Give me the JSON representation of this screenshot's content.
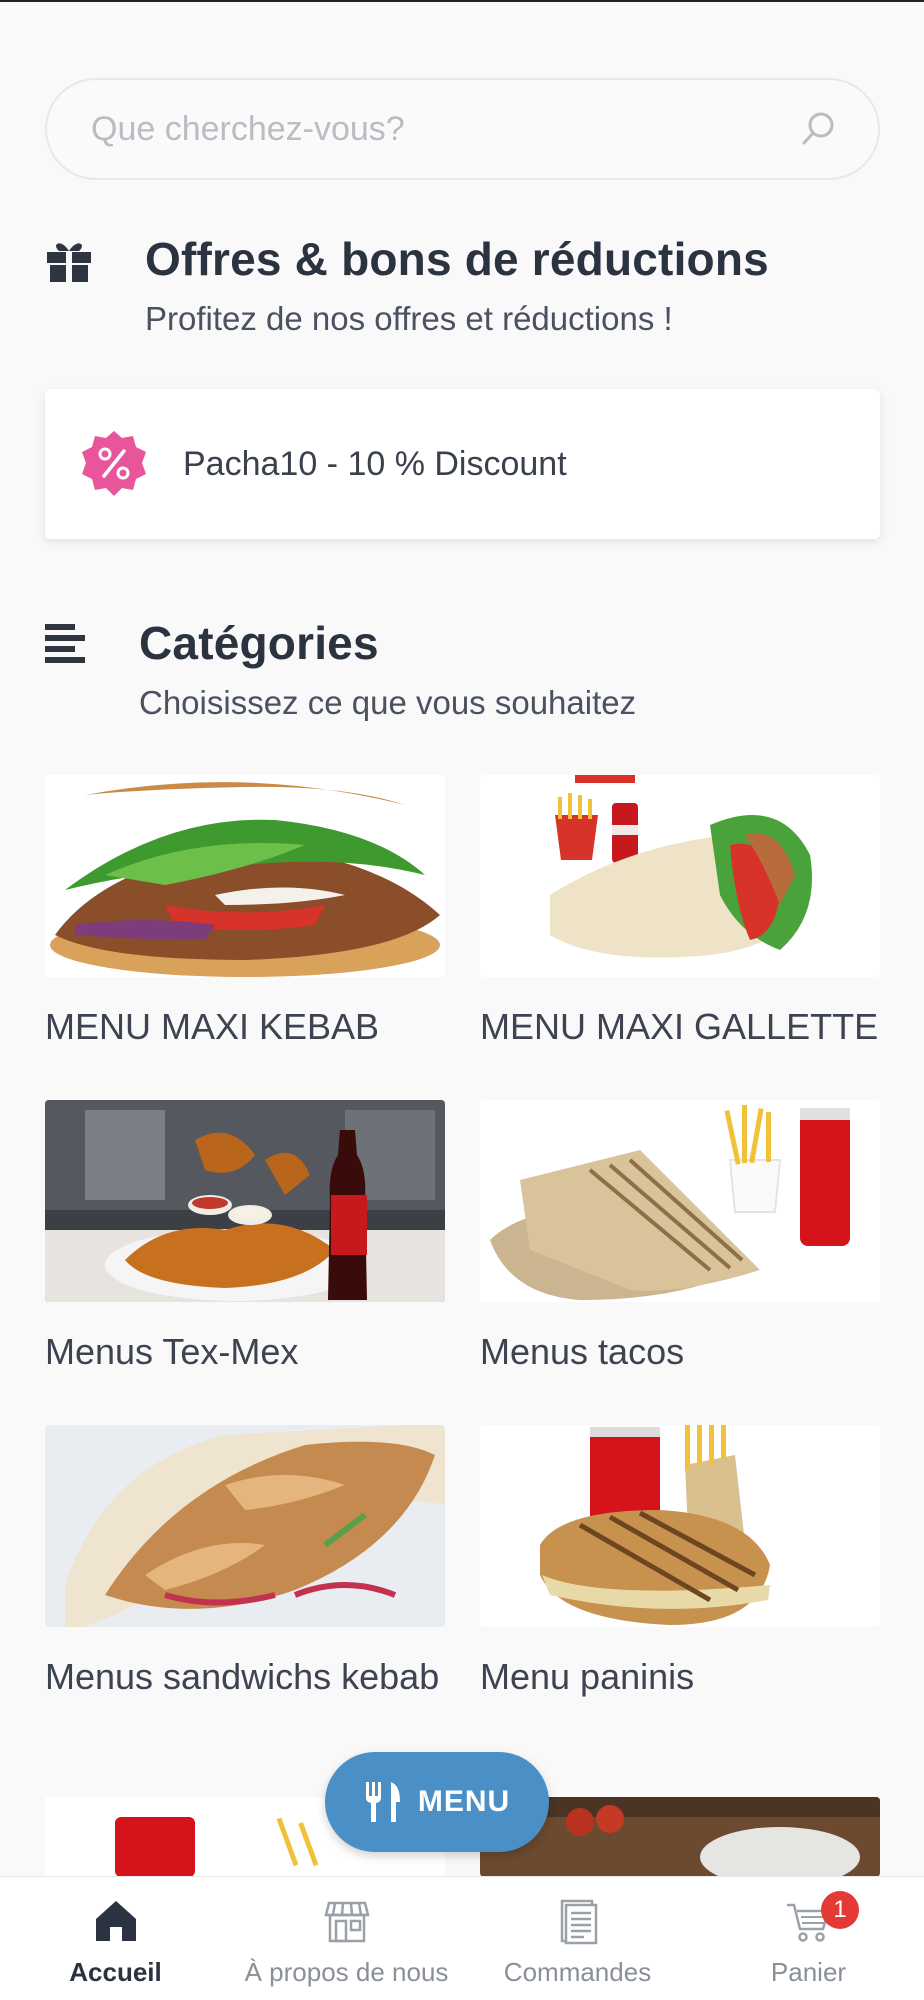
{
  "search": {
    "placeholder": "Que cherchez-vous?"
  },
  "offers": {
    "title": "Offres & bons de réductions",
    "subtitle": "Profitez de nos offres et réductions !",
    "coupon": "Pacha10 - 10 % Discount"
  },
  "categories": {
    "title": "Catégories",
    "subtitle": "Choisissez ce que vous souhaitez",
    "items": [
      {
        "label": "MENU MAXI KEBAB"
      },
      {
        "label": "MENU MAXI GALLETTE"
      },
      {
        "label": "Menus Tex-Mex"
      },
      {
        "label": "Menus tacos"
      },
      {
        "label": "Menus sandwichs kebab"
      },
      {
        "label": "Menu paninis"
      }
    ]
  },
  "fab": {
    "label": "MENU"
  },
  "nav": {
    "home": "Accueil",
    "about": "À propos de nous",
    "orders": "Commandes",
    "cart": "Panier",
    "cart_count": "1"
  },
  "colors": {
    "accent": "#4a90c6",
    "coupon_badge": "#e8559a",
    "cart_badge": "#e53935"
  }
}
